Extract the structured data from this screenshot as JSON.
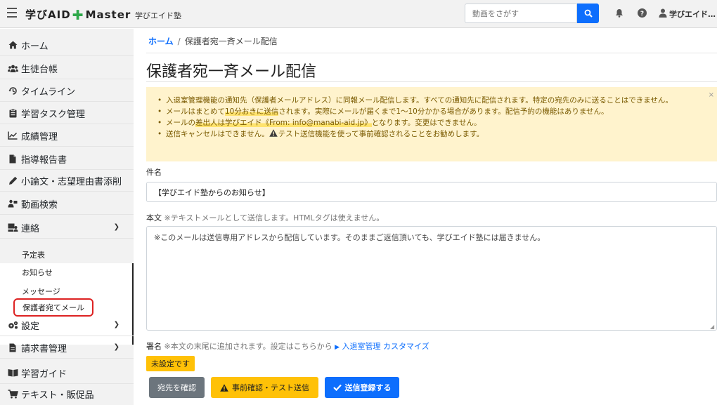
{
  "header": {
    "brand_left": "学びAID",
    "brand_right": "Master",
    "school": "学びエイド塾",
    "search_placeholder": "動画をさがす",
    "user": "学びエイド…",
    "icons": [
      "bell-icon",
      "question-icon",
      "user-icon",
      "search-icon"
    ],
    "accent_color": "#0d6efd",
    "brand_cross_color": "#2ea84a"
  },
  "sidebar": {
    "items": [
      {
        "label": "ホーム",
        "icon": "home-icon"
      },
      {
        "label": "生徒台帳",
        "icon": "users-icon"
      },
      {
        "label": "タイムライン",
        "icon": "history-icon"
      },
      {
        "label": "学習タスク管理",
        "icon": "clipboard-icon"
      },
      {
        "label": "成績管理",
        "icon": "chart-icon"
      },
      {
        "label": "指導報告書",
        "icon": "file-icon"
      },
      {
        "label": "小論文・志望理由書添削",
        "icon": "pen-icon"
      },
      {
        "label": "動画検索",
        "icon": "video-user-icon"
      },
      {
        "label": "連絡",
        "icon": "contact-icon"
      },
      {
        "label": "設定",
        "icon": "gears-icon"
      },
      {
        "label": "請求書管理",
        "icon": "invoice-icon"
      },
      {
        "label": "学習ガイド",
        "icon": "book-icon"
      },
      {
        "label": "テキスト・販促品",
        "icon": "cart-icon"
      }
    ],
    "contact_sub": [
      "予定表",
      "お知らせ",
      "メッセージ",
      "保護者宛てメール"
    ]
  },
  "breadcrumb": {
    "home": "ホーム",
    "separator": "/",
    "current": "保護者宛一斉メール配信"
  },
  "page_title": "保護者宛一斉メール配信",
  "alert": {
    "line1": "入退室管理機能の通知先（保護者メールアドレス）に同報メール配信します。すべての通知先に配信されます。特定の宛先のみに送ることはできません。",
    "line2_a": "メールはまとめて",
    "line2_hl": "10分おきに送信",
    "line2_b": "されます。実際にメールが届くまで1〜10分かかる場合があります。配信予約の機能はありません。",
    "line3_a": "メールの",
    "line3_hl": "差出人は学びエイド《From: info@manabi-aid.jp》",
    "line3_b": "となります。変更はできません。",
    "line4_a": "送信キャンセルはできません。",
    "line4_b": "テスト送信機能を使って事前確認されることをお勧めします。",
    "close": "×"
  },
  "form": {
    "subject_label": "件名",
    "subject_value": "【学びエイド塾からのお知らせ】",
    "body_label": "本文",
    "body_note": "※テキストメールとして送信します。HTMLタグは使えません。",
    "body_value": "※このメールは送信専用アドレスから配信しています。そのままご返信頂いても、学びエイド塾には届きません。",
    "sig_label": "署名",
    "sig_note": "※本文の末尾に追加されます。設定はこちらから",
    "sig_link": "入退室管理 カスタマイズ",
    "sig_status": "未設定です"
  },
  "buttons": {
    "confirm": "宛先を確認",
    "test": "事前確認・テスト送信",
    "submit": "送信登録する"
  }
}
